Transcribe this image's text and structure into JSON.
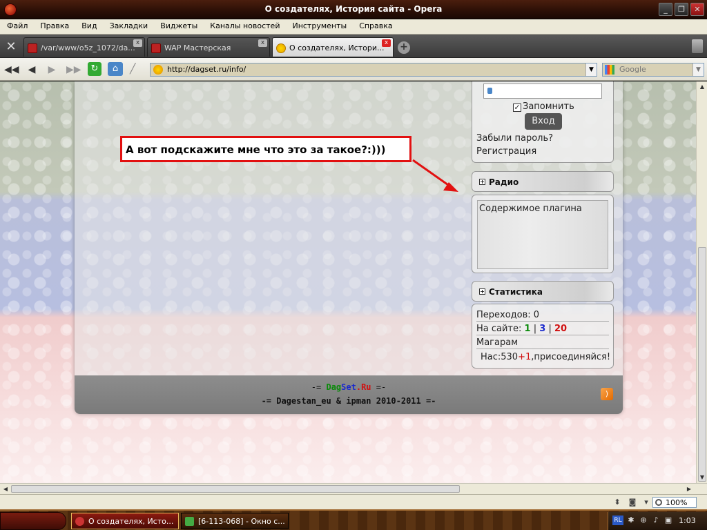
{
  "window": {
    "title": "О создателях, История сайта - Opera"
  },
  "menu": [
    "Файл",
    "Правка",
    "Вид",
    "Закладки",
    "Виджеты",
    "Каналы новостей",
    "Инструменты",
    "Справка"
  ],
  "tabs": [
    {
      "label": "/var/www/o5z_1072/da..."
    },
    {
      "label": "WAP Мастерская"
    },
    {
      "label": "О создателях, Истори..."
    }
  ],
  "address": {
    "url": "http://dagset.ru/info/",
    "search_placeholder": "Google"
  },
  "login": {
    "remember_label": "Запомнить",
    "login_button": "Вход",
    "forgot_link": "Забыли пароль?",
    "register_link": "Регистрация"
  },
  "radio": {
    "title": "Радио",
    "content": "Содержимое плагина"
  },
  "stats": {
    "title": "Статистика",
    "transitions_label": "Переходов:",
    "transitions_value": "0",
    "online_label": "На сайте:",
    "online_1": "1",
    "online_2": "3",
    "online_3": "20",
    "sep": "|",
    "user": "Магарам",
    "members_prefix": "Нас:530",
    "members_new": "+1",
    "members_suffix": ",присоединяйся!"
  },
  "footer": {
    "dash_left": "-= ",
    "brand_dag": "Dag",
    "brand_set": "Set",
    "brand_ru": ".Ru",
    "dash_right": " =-",
    "credits": "-= Dagestan_eu & ipman 2010-2011 =-"
  },
  "annotation": {
    "text": "А вот подскажите мне что это за такое?:)))"
  },
  "status": {
    "zoom": "100%"
  },
  "taskbar": {
    "tasks": [
      {
        "label": "О создателях, Исто..."
      },
      {
        "label": "[6-113-068] - Окно с..."
      }
    ],
    "lang": "RL",
    "clock": "1:03"
  },
  "colors": {
    "callout_border": "#e21010",
    "online_green": "#0a8a0a",
    "online_blue": "#1a2acc",
    "online_red": "#d01010"
  }
}
